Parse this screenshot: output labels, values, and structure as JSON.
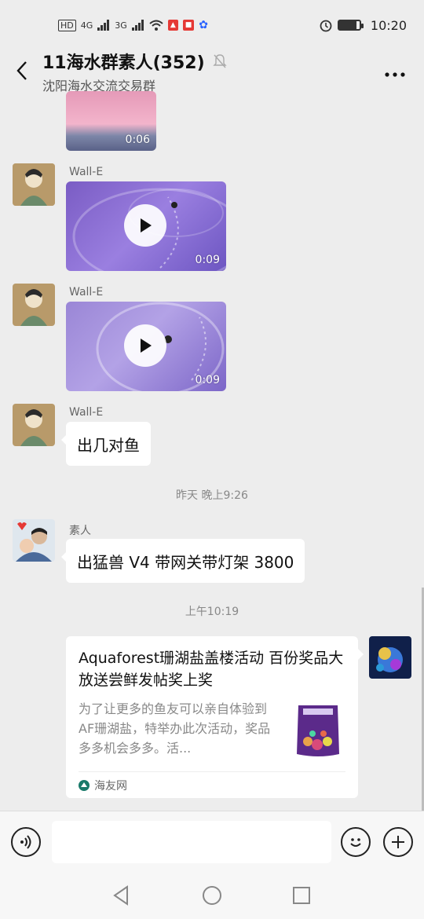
{
  "status_bar": {
    "network_left": "HD",
    "signal1": "4G",
    "signal2": "3G",
    "time": "10:20",
    "battery_level": 0.85
  },
  "header": {
    "title": "11海水群素人(352)",
    "subtitle": "沈阳海水交流交易群"
  },
  "messages": {
    "video0": {
      "duration": "0:06"
    },
    "msg1": {
      "sender": "Wall-E",
      "duration": "0:09"
    },
    "msg2": {
      "sender": "Wall-E",
      "duration": "0:09"
    },
    "msg3": {
      "sender": "Wall-E",
      "text": "出几对鱼"
    },
    "time1": "昨天 晚上9:26",
    "msg4": {
      "sender": "素人",
      "text": "出猛兽 V4 带网关带灯架 3800"
    },
    "time2": "上午10:19",
    "card": {
      "title": "Aquaforest珊湖盐盖楼活动 百份奖品大放送尝鲜发帖奖上奖",
      "description": "为了让更多的鱼友可以亲自体验到AF珊湖盐，特举办此次活动，奖品多多机会多多。活...",
      "source": "海友网"
    }
  },
  "input": {
    "placeholder": ""
  },
  "colors": {
    "bg": "#ededed",
    "bubble": "#ffffff",
    "video": "#8a6fd8"
  }
}
